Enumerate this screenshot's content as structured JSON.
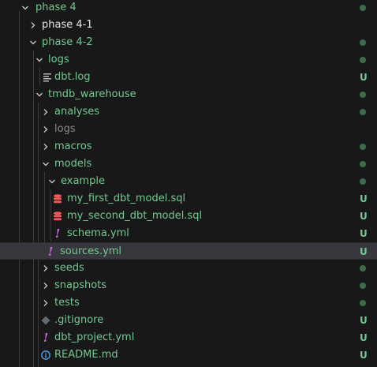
{
  "colors": {
    "modified": "#73c991",
    "normal": "#e6e6e6",
    "ignored": "#8b8b8b",
    "status_dot": "#3f6b4b",
    "sql_icon": "#f25858",
    "yml_icon": "#c26be0",
    "log_icon": "#b4b4b4",
    "git_icon": "#5f6b76",
    "info_icon": "#4ea2f0"
  },
  "status_badge": "U",
  "explorer": {
    "items": [
      {
        "label": "phase 4",
        "type": "folder",
        "expanded": true,
        "color": "green",
        "status": "dot"
      },
      {
        "label": "phase 4-1",
        "type": "folder",
        "expanded": false,
        "color": "white",
        "status": ""
      },
      {
        "label": "phase 4-2",
        "type": "folder",
        "expanded": true,
        "color": "green",
        "status": "dot"
      },
      {
        "label": "logs",
        "type": "folder",
        "expanded": true,
        "color": "green",
        "status": "dot"
      },
      {
        "label": "dbt.log",
        "type": "file",
        "icon": "log-file-icon",
        "color": "green",
        "status": "U"
      },
      {
        "label": "tmdb_warehouse",
        "type": "folder",
        "expanded": true,
        "color": "green",
        "status": "dot"
      },
      {
        "label": "analyses",
        "type": "folder",
        "expanded": false,
        "color": "green",
        "status": "dot"
      },
      {
        "label": "logs",
        "type": "folder",
        "expanded": false,
        "color": "gray",
        "status": ""
      },
      {
        "label": "macros",
        "type": "folder",
        "expanded": false,
        "color": "green",
        "status": "dot"
      },
      {
        "label": "models",
        "type": "folder",
        "expanded": true,
        "color": "green",
        "status": "dot"
      },
      {
        "label": "example",
        "type": "folder",
        "expanded": true,
        "color": "green",
        "status": "dot"
      },
      {
        "label": "my_first_dbt_model.sql",
        "type": "file",
        "icon": "database-icon",
        "color": "green",
        "status": "U"
      },
      {
        "label": "my_second_dbt_model.sql",
        "type": "file",
        "icon": "database-icon",
        "color": "green",
        "status": "U"
      },
      {
        "label": "schema.yml",
        "type": "file",
        "icon": "yaml-icon",
        "color": "green",
        "status": "U"
      },
      {
        "label": "sources.yml",
        "type": "file",
        "icon": "yaml-icon",
        "color": "green",
        "status": "U",
        "selected": true
      },
      {
        "label": "seeds",
        "type": "folder",
        "expanded": false,
        "color": "green",
        "status": "dot"
      },
      {
        "label": "snapshots",
        "type": "folder",
        "expanded": false,
        "color": "green",
        "status": "dot"
      },
      {
        "label": "tests",
        "type": "folder",
        "expanded": false,
        "color": "green",
        "status": "dot"
      },
      {
        "label": ".gitignore",
        "type": "file",
        "icon": "git-icon",
        "color": "green",
        "status": "U"
      },
      {
        "label": "dbt_project.yml",
        "type": "file",
        "icon": "yaml-icon",
        "color": "green",
        "status": "U"
      },
      {
        "label": "README.md",
        "type": "file",
        "icon": "info-icon",
        "color": "green",
        "status": "U"
      }
    ]
  }
}
